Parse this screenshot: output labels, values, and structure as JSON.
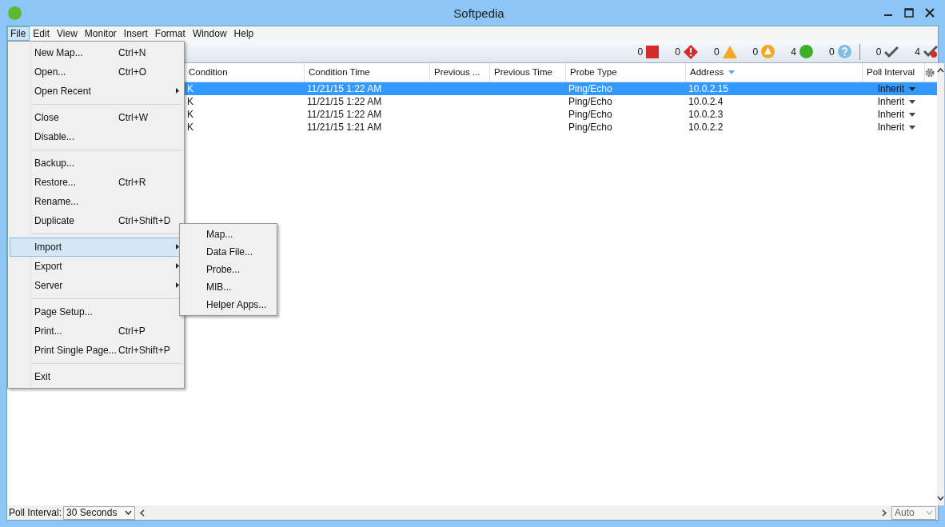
{
  "window": {
    "title": "Softpedia"
  },
  "menubar": [
    {
      "label": "File",
      "selected": true
    },
    {
      "label": "Edit",
      "selected": false
    },
    {
      "label": "View",
      "selected": false
    },
    {
      "label": "Monitor",
      "selected": false
    },
    {
      "label": "Insert",
      "selected": false
    },
    {
      "label": "Format",
      "selected": false
    },
    {
      "label": "Window",
      "selected": false
    },
    {
      "label": "Help",
      "selected": false
    }
  ],
  "status_counts": [
    {
      "kind": "down",
      "count": "0"
    },
    {
      "kind": "alarm",
      "count": "0"
    },
    {
      "kind": "warning",
      "count": "0"
    },
    {
      "kind": "caution",
      "count": "0"
    },
    {
      "kind": "up",
      "count": "4"
    },
    {
      "kind": "unknown",
      "count": "0"
    },
    {
      "kind": "separator"
    },
    {
      "kind": "acked",
      "count": "0"
    },
    {
      "kind": "unacked",
      "count": "4"
    }
  ],
  "table": {
    "columns": [
      {
        "label": "Condition",
        "sorted": false
      },
      {
        "label": "Condition Time",
        "sorted": false
      },
      {
        "label": "Previous ...",
        "sorted": false
      },
      {
        "label": "Previous Time",
        "sorted": false
      },
      {
        "label": "Probe Type",
        "sorted": false
      },
      {
        "label": "Address",
        "sorted": true
      },
      {
        "label": "Poll Interval",
        "sorted": false
      }
    ],
    "rows": [
      {
        "selected": true,
        "cells": [
          "K",
          "11/21/15 1:22 AM",
          "",
          "",
          "Ping/Echo",
          "10.0.2.15",
          "Inherit"
        ]
      },
      {
        "selected": false,
        "cells": [
          "K",
          "11/21/15 1:22 AM",
          "",
          "",
          "Ping/Echo",
          "10.0.2.4",
          "Inherit"
        ]
      },
      {
        "selected": false,
        "cells": [
          "K",
          "11/21/15 1:22 AM",
          "",
          "",
          "Ping/Echo",
          "10.0.2.3",
          "Inherit"
        ]
      },
      {
        "selected": false,
        "cells": [
          "K",
          "11/21/15 1:21 AM",
          "",
          "",
          "Ping/Echo",
          "10.0.2.2",
          "Inherit"
        ]
      }
    ]
  },
  "file_menu": [
    {
      "kind": "item",
      "label": "New Map...",
      "shortcut": "Ctrl+N",
      "submenu": false,
      "selected": false
    },
    {
      "kind": "item",
      "label": "Open...",
      "shortcut": "Ctrl+O",
      "submenu": false,
      "selected": false
    },
    {
      "kind": "item",
      "label": "Open Recent",
      "submenu": true,
      "selected": false
    },
    {
      "kind": "separator"
    },
    {
      "kind": "item",
      "label": "Close",
      "shortcut": "Ctrl+W",
      "submenu": false,
      "selected": false
    },
    {
      "kind": "item",
      "label": "Disable...",
      "submenu": false,
      "selected": false
    },
    {
      "kind": "separator"
    },
    {
      "kind": "item",
      "label": "Backup...",
      "submenu": false,
      "selected": false
    },
    {
      "kind": "item",
      "label": "Restore...",
      "shortcut": "Ctrl+R",
      "submenu": false,
      "selected": false
    },
    {
      "kind": "item",
      "label": "Rename...",
      "submenu": false,
      "selected": false
    },
    {
      "kind": "item",
      "label": "Duplicate",
      "shortcut": "Ctrl+Shift+D",
      "submenu": false,
      "selected": false
    },
    {
      "kind": "separator"
    },
    {
      "kind": "item",
      "label": "Import",
      "submenu": true,
      "selected": true
    },
    {
      "kind": "item",
      "label": "Export",
      "submenu": true,
      "selected": false
    },
    {
      "kind": "item",
      "label": "Server",
      "submenu": true,
      "selected": false
    },
    {
      "kind": "separator"
    },
    {
      "kind": "item",
      "label": "Page Setup...",
      "submenu": false,
      "selected": false
    },
    {
      "kind": "item",
      "label": "Print...",
      "shortcut": "Ctrl+P",
      "submenu": false,
      "selected": false
    },
    {
      "kind": "item",
      "label": "Print Single Page...",
      "shortcut": "Ctrl+Shift+P",
      "submenu": false,
      "selected": false
    },
    {
      "kind": "separator"
    },
    {
      "kind": "item",
      "label": "Exit",
      "submenu": false,
      "selected": false
    }
  ],
  "import_submenu": [
    "Map...",
    "Data File...",
    "Probe...",
    "MIB...",
    "Helper Apps..."
  ],
  "status_bar": {
    "label": "Poll Interval:",
    "poll_interval": "30 Seconds",
    "zoom": "Auto",
    "zoom_disabled": true
  }
}
